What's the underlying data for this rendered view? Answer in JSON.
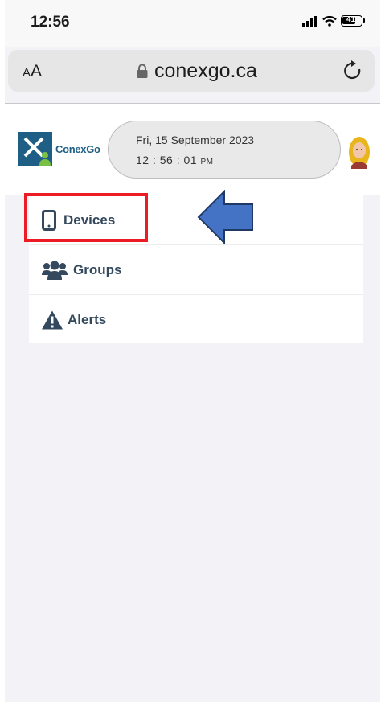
{
  "status_bar": {
    "time": "12:56",
    "battery": "41"
  },
  "browser": {
    "text_size_small": "A",
    "text_size_large": "A",
    "url": "conexgo.ca"
  },
  "header": {
    "logo_text": "ConexGo",
    "date": "Fri, 15 September 2023",
    "time": "12 : 56 : 01",
    "ampm": "PM"
  },
  "menu": {
    "items": [
      {
        "label": "Devices",
        "icon": "mobile-icon"
      },
      {
        "label": "Groups",
        "icon": "users-icon"
      },
      {
        "label": "Alerts",
        "icon": "warning-icon"
      }
    ]
  },
  "annotation": {
    "highlight_color": "#ec1c24",
    "arrow_color": "#4472c4"
  }
}
